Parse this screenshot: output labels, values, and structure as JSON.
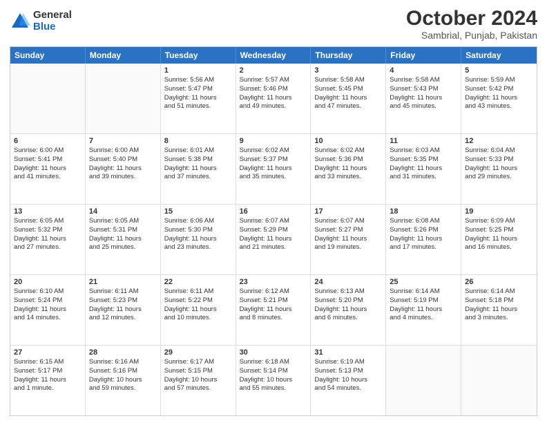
{
  "logo": {
    "general": "General",
    "blue": "Blue"
  },
  "title": "October 2024",
  "subtitle": "Sambrial, Punjab, Pakistan",
  "header_days": [
    "Sunday",
    "Monday",
    "Tuesday",
    "Wednesday",
    "Thursday",
    "Friday",
    "Saturday"
  ],
  "rows": [
    [
      {
        "day": "",
        "lines": [],
        "empty": true
      },
      {
        "day": "",
        "lines": [],
        "empty": true
      },
      {
        "day": "1",
        "lines": [
          "Sunrise: 5:56 AM",
          "Sunset: 5:47 PM",
          "Daylight: 11 hours",
          "and 51 minutes."
        ],
        "empty": false
      },
      {
        "day": "2",
        "lines": [
          "Sunrise: 5:57 AM",
          "Sunset: 5:46 PM",
          "Daylight: 11 hours",
          "and 49 minutes."
        ],
        "empty": false
      },
      {
        "day": "3",
        "lines": [
          "Sunrise: 5:58 AM",
          "Sunset: 5:45 PM",
          "Daylight: 11 hours",
          "and 47 minutes."
        ],
        "empty": false
      },
      {
        "day": "4",
        "lines": [
          "Sunrise: 5:58 AM",
          "Sunset: 5:43 PM",
          "Daylight: 11 hours",
          "and 45 minutes."
        ],
        "empty": false
      },
      {
        "day": "5",
        "lines": [
          "Sunrise: 5:59 AM",
          "Sunset: 5:42 PM",
          "Daylight: 11 hours",
          "and 43 minutes."
        ],
        "empty": false
      }
    ],
    [
      {
        "day": "6",
        "lines": [
          "Sunrise: 6:00 AM",
          "Sunset: 5:41 PM",
          "Daylight: 11 hours",
          "and 41 minutes."
        ],
        "empty": false
      },
      {
        "day": "7",
        "lines": [
          "Sunrise: 6:00 AM",
          "Sunset: 5:40 PM",
          "Daylight: 11 hours",
          "and 39 minutes."
        ],
        "empty": false
      },
      {
        "day": "8",
        "lines": [
          "Sunrise: 6:01 AM",
          "Sunset: 5:38 PM",
          "Daylight: 11 hours",
          "and 37 minutes."
        ],
        "empty": false
      },
      {
        "day": "9",
        "lines": [
          "Sunrise: 6:02 AM",
          "Sunset: 5:37 PM",
          "Daylight: 11 hours",
          "and 35 minutes."
        ],
        "empty": false
      },
      {
        "day": "10",
        "lines": [
          "Sunrise: 6:02 AM",
          "Sunset: 5:36 PM",
          "Daylight: 11 hours",
          "and 33 minutes."
        ],
        "empty": false
      },
      {
        "day": "11",
        "lines": [
          "Sunrise: 6:03 AM",
          "Sunset: 5:35 PM",
          "Daylight: 11 hours",
          "and 31 minutes."
        ],
        "empty": false
      },
      {
        "day": "12",
        "lines": [
          "Sunrise: 6:04 AM",
          "Sunset: 5:33 PM",
          "Daylight: 11 hours",
          "and 29 minutes."
        ],
        "empty": false
      }
    ],
    [
      {
        "day": "13",
        "lines": [
          "Sunrise: 6:05 AM",
          "Sunset: 5:32 PM",
          "Daylight: 11 hours",
          "and 27 minutes."
        ],
        "empty": false
      },
      {
        "day": "14",
        "lines": [
          "Sunrise: 6:05 AM",
          "Sunset: 5:31 PM",
          "Daylight: 11 hours",
          "and 25 minutes."
        ],
        "empty": false
      },
      {
        "day": "15",
        "lines": [
          "Sunrise: 6:06 AM",
          "Sunset: 5:30 PM",
          "Daylight: 11 hours",
          "and 23 minutes."
        ],
        "empty": false
      },
      {
        "day": "16",
        "lines": [
          "Sunrise: 6:07 AM",
          "Sunset: 5:29 PM",
          "Daylight: 11 hours",
          "and 21 minutes."
        ],
        "empty": false
      },
      {
        "day": "17",
        "lines": [
          "Sunrise: 6:07 AM",
          "Sunset: 5:27 PM",
          "Daylight: 11 hours",
          "and 19 minutes."
        ],
        "empty": false
      },
      {
        "day": "18",
        "lines": [
          "Sunrise: 6:08 AM",
          "Sunset: 5:26 PM",
          "Daylight: 11 hours",
          "and 17 minutes."
        ],
        "empty": false
      },
      {
        "day": "19",
        "lines": [
          "Sunrise: 6:09 AM",
          "Sunset: 5:25 PM",
          "Daylight: 11 hours",
          "and 16 minutes."
        ],
        "empty": false
      }
    ],
    [
      {
        "day": "20",
        "lines": [
          "Sunrise: 6:10 AM",
          "Sunset: 5:24 PM",
          "Daylight: 11 hours",
          "and 14 minutes."
        ],
        "empty": false
      },
      {
        "day": "21",
        "lines": [
          "Sunrise: 6:11 AM",
          "Sunset: 5:23 PM",
          "Daylight: 11 hours",
          "and 12 minutes."
        ],
        "empty": false
      },
      {
        "day": "22",
        "lines": [
          "Sunrise: 6:11 AM",
          "Sunset: 5:22 PM",
          "Daylight: 11 hours",
          "and 10 minutes."
        ],
        "empty": false
      },
      {
        "day": "23",
        "lines": [
          "Sunrise: 6:12 AM",
          "Sunset: 5:21 PM",
          "Daylight: 11 hours",
          "and 8 minutes."
        ],
        "empty": false
      },
      {
        "day": "24",
        "lines": [
          "Sunrise: 6:13 AM",
          "Sunset: 5:20 PM",
          "Daylight: 11 hours",
          "and 6 minutes."
        ],
        "empty": false
      },
      {
        "day": "25",
        "lines": [
          "Sunrise: 6:14 AM",
          "Sunset: 5:19 PM",
          "Daylight: 11 hours",
          "and 4 minutes."
        ],
        "empty": false
      },
      {
        "day": "26",
        "lines": [
          "Sunrise: 6:14 AM",
          "Sunset: 5:18 PM",
          "Daylight: 11 hours",
          "and 3 minutes."
        ],
        "empty": false
      }
    ],
    [
      {
        "day": "27",
        "lines": [
          "Sunrise: 6:15 AM",
          "Sunset: 5:17 PM",
          "Daylight: 11 hours",
          "and 1 minute."
        ],
        "empty": false
      },
      {
        "day": "28",
        "lines": [
          "Sunrise: 6:16 AM",
          "Sunset: 5:16 PM",
          "Daylight: 10 hours",
          "and 59 minutes."
        ],
        "empty": false
      },
      {
        "day": "29",
        "lines": [
          "Sunrise: 6:17 AM",
          "Sunset: 5:15 PM",
          "Daylight: 10 hours",
          "and 57 minutes."
        ],
        "empty": false
      },
      {
        "day": "30",
        "lines": [
          "Sunrise: 6:18 AM",
          "Sunset: 5:14 PM",
          "Daylight: 10 hours",
          "and 55 minutes."
        ],
        "empty": false
      },
      {
        "day": "31",
        "lines": [
          "Sunrise: 6:19 AM",
          "Sunset: 5:13 PM",
          "Daylight: 10 hours",
          "and 54 minutes."
        ],
        "empty": false
      },
      {
        "day": "",
        "lines": [],
        "empty": true
      },
      {
        "day": "",
        "lines": [],
        "empty": true
      }
    ]
  ]
}
